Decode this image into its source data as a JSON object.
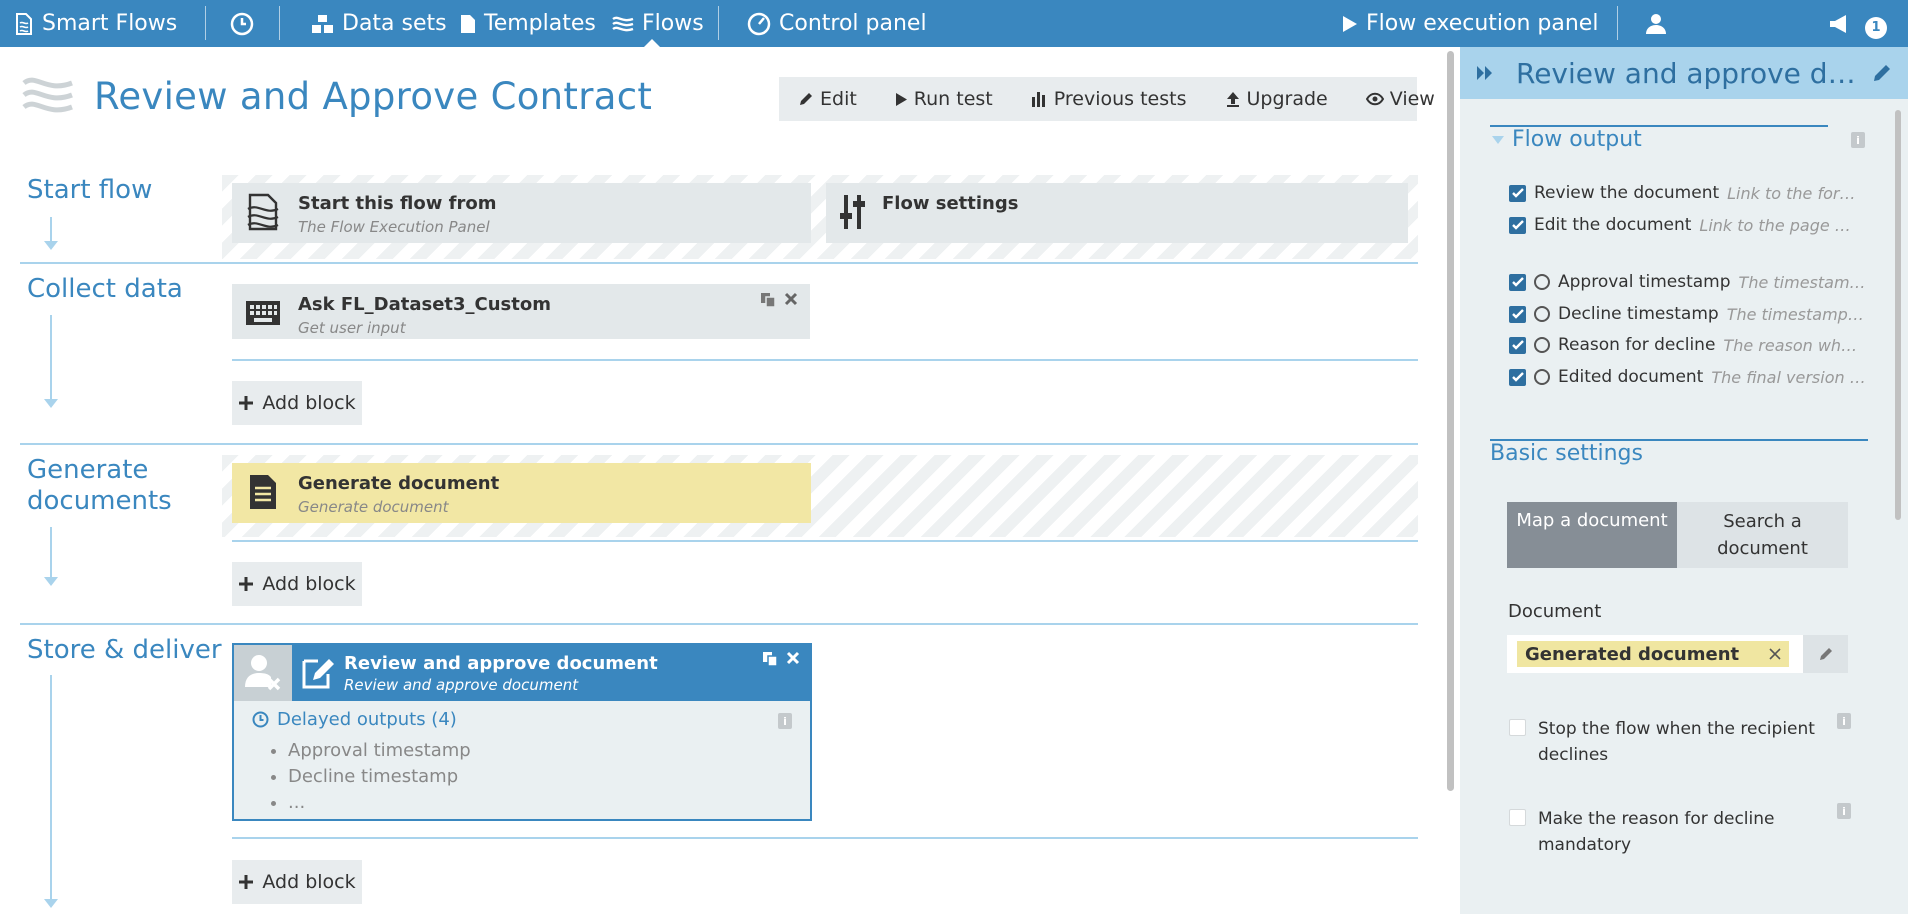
{
  "colors": {
    "brand": "#3a87bf",
    "light_blue": "#a9d3ec",
    "block_gray": "#e3e8ea",
    "block_yellow": "#f2e7a4",
    "panel_bg": "#eaf0f2"
  },
  "nav": {
    "brand": "Smart Flows",
    "history_icon": "clock-icon",
    "datasets": "Data sets",
    "templates": "Templates",
    "flows": "Flows",
    "control_panel": "Control panel",
    "flow_exec": "Flow execution panel",
    "user_icon": "user-icon",
    "notifications_count": "1"
  },
  "page": {
    "title": "Review and Approve Contract"
  },
  "toolbar": {
    "edit": "Edit",
    "run_test": "Run test",
    "previous_tests": "Previous tests",
    "upgrade": "Upgrade",
    "view": "View"
  },
  "sections": {
    "start": "Start flow",
    "collect": "Collect data",
    "generate_1": "Generate",
    "generate_2": "documents",
    "store": "Store & deliver"
  },
  "blocks": {
    "start_from": {
      "title": "Start this flow from",
      "subtitle": "The Flow Execution Panel"
    },
    "flow_settings": {
      "title": "Flow settings"
    },
    "ask": {
      "title": "Ask FL_Dataset3_Custom",
      "subtitle": "Get user input"
    },
    "generate": {
      "title": "Generate document",
      "subtitle": "Generate document"
    },
    "review": {
      "title": "Review and approve document",
      "subtitle": "Review and approve document",
      "delayed_outputs": "Delayed outputs (4)",
      "items": [
        "Approval timestamp",
        "Decline timestamp",
        "..."
      ]
    }
  },
  "add_block": "Add block",
  "panel": {
    "title": "Review and approve document",
    "flow_output": "Flow output",
    "outputs": [
      {
        "label": "Review the document",
        "desc": "Link to the form ...",
        "clock": false
      },
      {
        "label": "Edit the document",
        "desc": "Link to the page wh...",
        "clock": false
      },
      {
        "label": "Approval timestamp",
        "desc": "The timestamp ...",
        "clock": true
      },
      {
        "label": "Decline timestamp",
        "desc": "The timestamp w...",
        "clock": true
      },
      {
        "label": "Reason for decline",
        "desc": "The reason why ...",
        "clock": true
      },
      {
        "label": "Edited document",
        "desc": "The final version of...",
        "clock": true
      }
    ],
    "basic_settings": "Basic settings",
    "map_document": "Map a document",
    "search_document_1": "Search a",
    "search_document_2": "document",
    "document_label": "Document",
    "document_value": "Generated document",
    "stop_flow_1": "Stop the flow when the recipient",
    "stop_flow_2": "declines",
    "reason_mandatory_1": "Make the reason for decline",
    "reason_mandatory_2": "mandatory"
  }
}
